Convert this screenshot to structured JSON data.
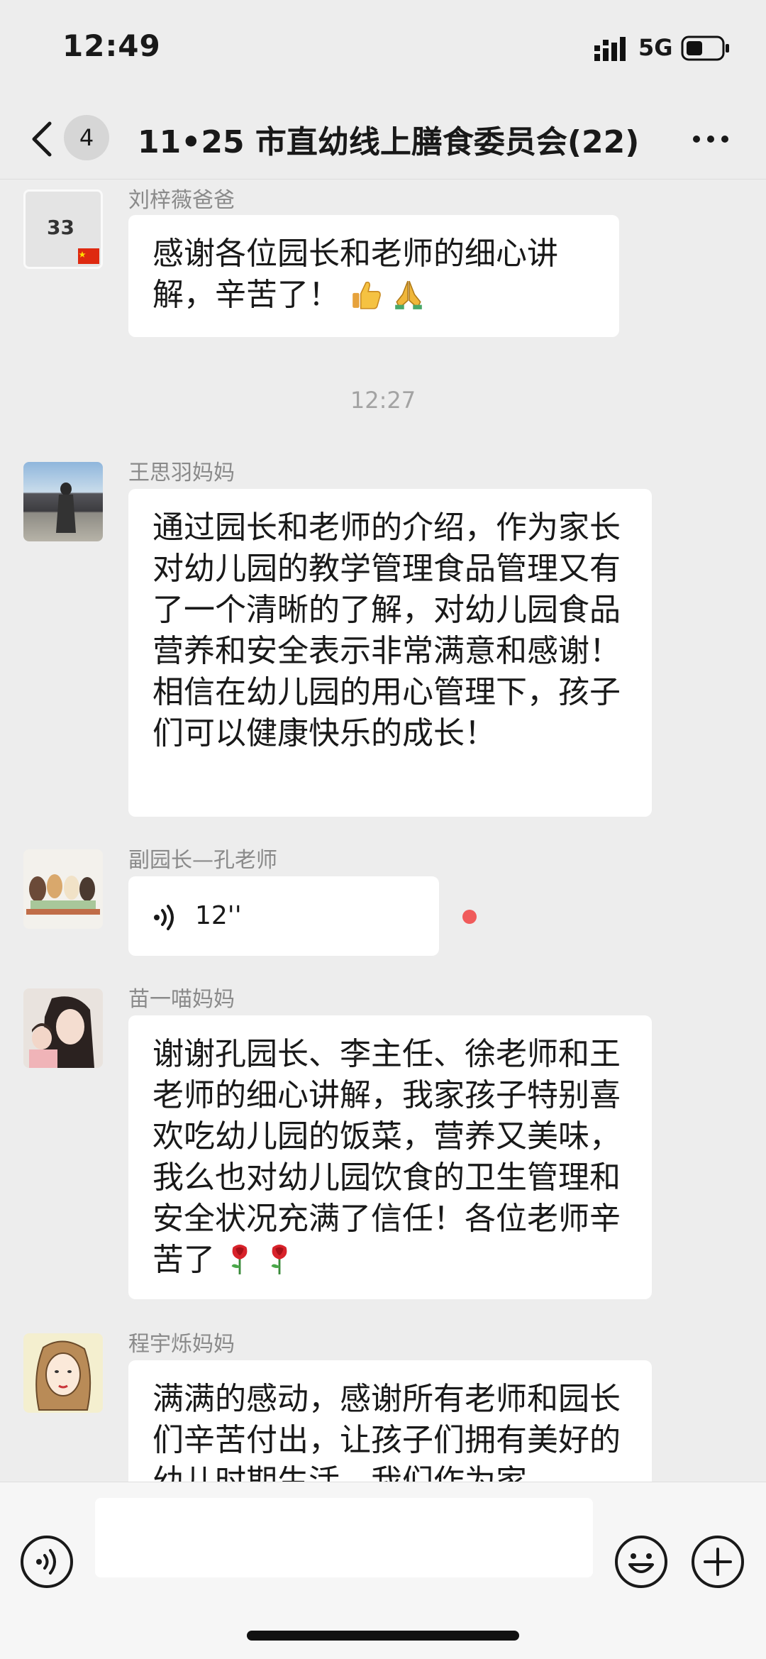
{
  "status_bar": {
    "time": "12:49",
    "network": "5G"
  },
  "nav": {
    "unread_count": "4",
    "title": "11•25 市直幼线上膳食委员会(22)"
  },
  "messages": [
    {
      "sender": "刘梓薇爸爸",
      "avatar_text": "33",
      "text": "感谢各位园长和老师的细心讲解，辛苦了！",
      "emojis": [
        "thumbs-up-icon",
        "praying-hands-icon"
      ]
    },
    {
      "timestamp": "12:27"
    },
    {
      "sender": "王思羽妈妈",
      "text": "通过园长和老师的介绍，作为家长对幼儿园的教学管理食品管理又有了一个清晰的了解，对幼儿园食品营养和安全表示非常满意和感谢！相信在幼儿园的用心管理下，孩子们可以健康快乐的成长！"
    },
    {
      "sender": "副园长—孔老师",
      "voice_duration": "12''"
    },
    {
      "sender": "苗一喵妈妈",
      "text": "谢谢孔园长、李主任、徐老师和王老师的细心讲解，我家孩子特别喜欢吃幼儿园的饭菜，营养又美味，我么也对幼儿园饮食的卫生管理和安全状况充满了信任！各位老师辛苦了",
      "emojis": [
        "rose-icon",
        "rose-icon"
      ]
    },
    {
      "sender": "程宇烁妈妈",
      "text": "满满的感动，感谢所有老师和园长们辛苦付出，让孩子们拥有美好的幼儿时期生活，我们作为家"
    }
  ],
  "colors": {
    "background": "#ededed",
    "bubble": "#ffffff",
    "unread_dot": "#f05b5b",
    "meta_text": "#8a8a8a"
  }
}
